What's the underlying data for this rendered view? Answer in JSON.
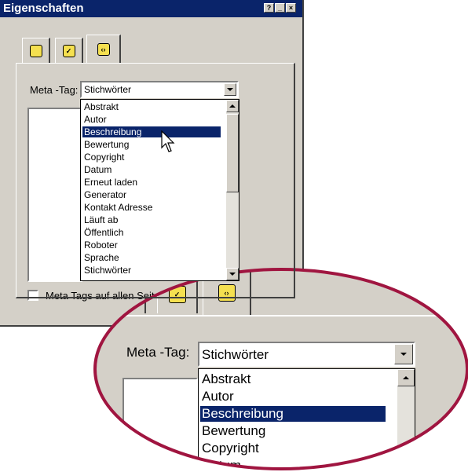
{
  "window": {
    "title": "Eigenschaften",
    "title_buttons": [
      "?",
      "_",
      "×"
    ]
  },
  "tabs": [
    {
      "icon": "page-icon",
      "color": "#f5e050"
    },
    {
      "icon": "check-page-icon",
      "color": "#f5e050"
    },
    {
      "icon": "meta-code-icon",
      "color": "#f5e050"
    }
  ],
  "meta_tag": {
    "label": "Meta -Tag:",
    "selected": "Stichwörter",
    "options": [
      "Abstrakt",
      "Autor",
      "Beschreibung",
      "Bewertung",
      "Copyright",
      "Datum",
      "Erneut laden",
      "Generator",
      "Kontakt Adresse",
      "Läuft ab",
      "Öffentlich",
      "Roboter",
      "Sprache",
      "Stichwörter"
    ],
    "highlighted": "Beschreibung"
  },
  "zoom": {
    "options_visible": [
      "Abstrakt",
      "Autor",
      "Beschreibung",
      "Bewertung",
      "Copyright",
      "Datum"
    ]
  },
  "checkbox": {
    "label": "Meta Tags auf allen Seiten"
  },
  "colors": {
    "titlebar": "#0a246a",
    "window_bg": "#d4d0c8",
    "selection": "#0a246a",
    "zoom_ring": "#a01540"
  }
}
